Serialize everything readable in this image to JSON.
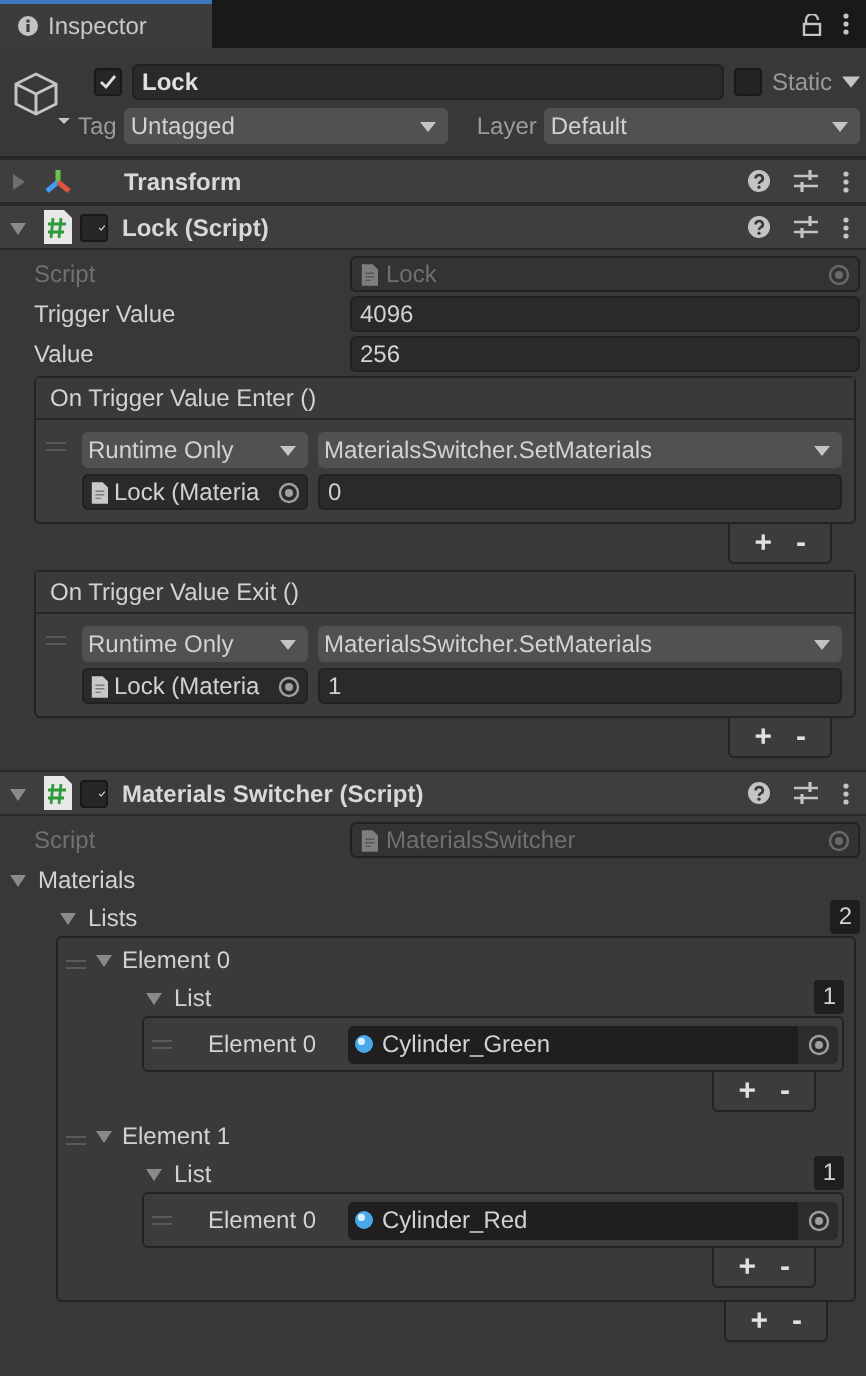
{
  "tab": {
    "label": "Inspector"
  },
  "object": {
    "active": true,
    "name": "Lock",
    "static": false,
    "static_label": "Static",
    "tag_label": "Tag",
    "tag": "Untagged",
    "layer_label": "Layer",
    "layer": "Default"
  },
  "components": [
    {
      "kind": "transform",
      "name": "Transform",
      "expanded": false
    },
    {
      "kind": "script",
      "name": "Lock (Script)",
      "enabled": true,
      "expanded": true,
      "fields": [
        {
          "kind": "object",
          "label": "Script",
          "value": "Lock",
          "disabled": true
        },
        {
          "kind": "text",
          "label": "Trigger Value",
          "value": "4096"
        },
        {
          "kind": "text",
          "label": "Value",
          "value": "256"
        },
        {
          "kind": "event",
          "label": "On Trigger Value Enter ()",
          "mode": "Runtime Only",
          "function": "MaterialsSwitcher.SetMaterials",
          "target": "Lock (Materia",
          "argument": "0",
          "add": "+",
          "remove": "-"
        },
        {
          "kind": "event",
          "label": "On Trigger Value Exit ()",
          "mode": "Runtime Only",
          "function": "MaterialsSwitcher.SetMaterials",
          "target": "Lock (Materia",
          "argument": "1",
          "add": "+",
          "remove": "-"
        }
      ]
    },
    {
      "kind": "script",
      "name": "Materials Switcher (Script)",
      "enabled": true,
      "expanded": true,
      "fields": [
        {
          "kind": "object",
          "label": "Script",
          "value": "MaterialsSwitcher",
          "disabled": true
        },
        {
          "kind": "foldout",
          "label": "Materials",
          "expanded": true,
          "lists": {
            "label": "Lists",
            "expanded": true,
            "count": "2",
            "add": "+",
            "remove": "-",
            "elements": [
              {
                "label": "Element 0",
                "expanded": true,
                "list": {
                  "label": "List",
                  "expanded": true,
                  "count": "1",
                  "add": "+",
                  "remove": "-",
                  "items": [
                    {
                      "label": "Element 0",
                      "value": "Cylinder_Green"
                    }
                  ]
                }
              },
              {
                "label": "Element 1",
                "expanded": true,
                "list": {
                  "label": "List",
                  "expanded": true,
                  "count": "1",
                  "add": "+",
                  "remove": "-",
                  "items": [
                    {
                      "label": "Element 0",
                      "value": "Cylinder_Red"
                    }
                  ]
                }
              }
            ]
          }
        }
      ]
    }
  ]
}
